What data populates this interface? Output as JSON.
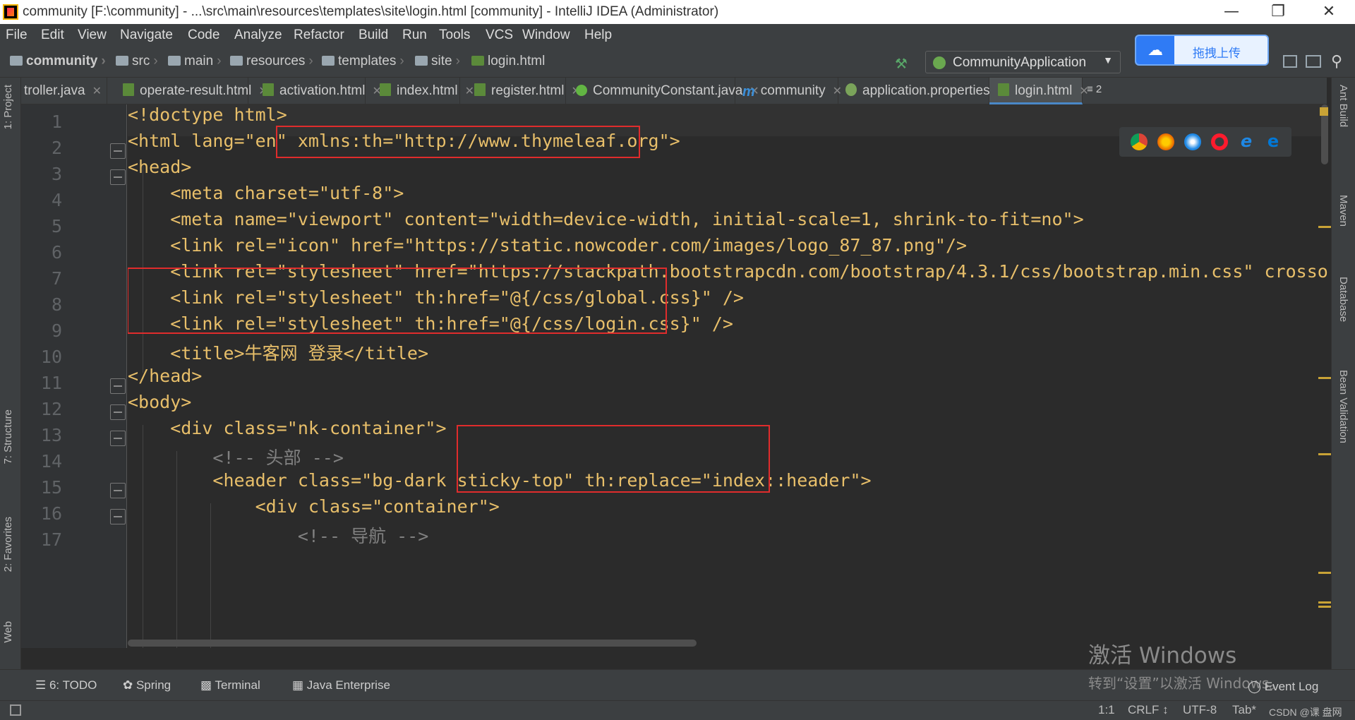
{
  "window": {
    "title": "community [F:\\community] - ...\\src\\main\\resources\\templates\\site\\login.html [community] - IntelliJ IDEA (Administrator)",
    "minimize": "—",
    "restore": "❐",
    "close": "✕"
  },
  "menu": [
    "File",
    "Edit",
    "View",
    "Navigate",
    "Code",
    "Analyze",
    "Refactor",
    "Build",
    "Run",
    "Tools",
    "VCS",
    "Window",
    "Help"
  ],
  "breadcrumb": [
    "community",
    "src",
    "main",
    "resources",
    "templates",
    "site",
    "login.html"
  ],
  "run_config": "CommunityApplication",
  "upload_button": "拖拽上传",
  "tabs": [
    {
      "label": "troller.java",
      "icon": "java-file-icon"
    },
    {
      "label": "operate-result.html",
      "icon": "html-file-icon"
    },
    {
      "label": "activation.html",
      "icon": "html-file-icon"
    },
    {
      "label": "index.html",
      "icon": "html-file-icon"
    },
    {
      "label": "register.html",
      "icon": "html-file-icon"
    },
    {
      "label": "CommunityConstant.java",
      "icon": "interface-icon"
    },
    {
      "label": "community",
      "icon": "maven-icon"
    },
    {
      "label": "application.properties",
      "icon": "properties-icon"
    },
    {
      "label": "login.html",
      "icon": "html-file-icon",
      "active": true
    }
  ],
  "tab_overflow": "≡ 2",
  "left_tools": [
    "1: Project",
    "7: Structure",
    "2: Favorites",
    "Web"
  ],
  "right_tools": [
    "Ant Build",
    "Maven",
    "Database",
    "Bean Validation"
  ],
  "line_numbers": [
    "1",
    "2",
    "3",
    "4",
    "5",
    "6",
    "7",
    "8",
    "9",
    "10",
    "11",
    "12",
    "13",
    "14",
    "15",
    "16",
    "17"
  ],
  "code_lines": [
    "<!doctype html>",
    "<html lang=\"en\" xmlns:th=\"http://www.thymeleaf.org\">",
    "<head>",
    "    <meta charset=\"utf-8\">",
    "    <meta name=\"viewport\" content=\"width=device-width, initial-scale=1, shrink-to-fit=no\">",
    "    <link rel=\"icon\" href=\"https://static.nowcoder.com/images/logo_87_87.png\"/>",
    "    <link rel=\"stylesheet\" href=\"https://stackpath.bootstrapcdn.com/bootstrap/4.3.1/css/bootstrap.min.css\" crossorigin",
    "    <link rel=\"stylesheet\" th:href=\"@{/css/global.css}\" />",
    "    <link rel=\"stylesheet\" th:href=\"@{/css/login.css}\" />",
    "    <title>牛客网 登录</title>",
    "</head>",
    "<body>",
    "    <div class=\"nk-container\">",
    "        <!-- 头部 -->",
    "        <header class=\"bg-dark sticky-top\" th:replace=\"index::header\">",
    "            <div class=\"container\">",
    "                <!-- 导航 -->"
  ],
  "bottom_tools": [
    "6: TODO",
    "Spring",
    "Terminal",
    "Java Enterprise"
  ],
  "event_log": "Event Log",
  "status": {
    "position": "1:1",
    "line_sep": "CRLF ↕",
    "encoding": "UTF-8",
    "indent": "Tab*",
    "extra": "CSDN @课 盘网"
  },
  "watermark": {
    "line1": "激活 Windows",
    "line2": "转到“设置”以激活 Windows。"
  },
  "colors": {
    "editor_bg": "#2b2b2b",
    "tag": "#e8bf6a",
    "attr_value": "#6a8759",
    "attr_name": "#bababa",
    "comment": "#808080",
    "annotation_box": "#e02c2c"
  }
}
